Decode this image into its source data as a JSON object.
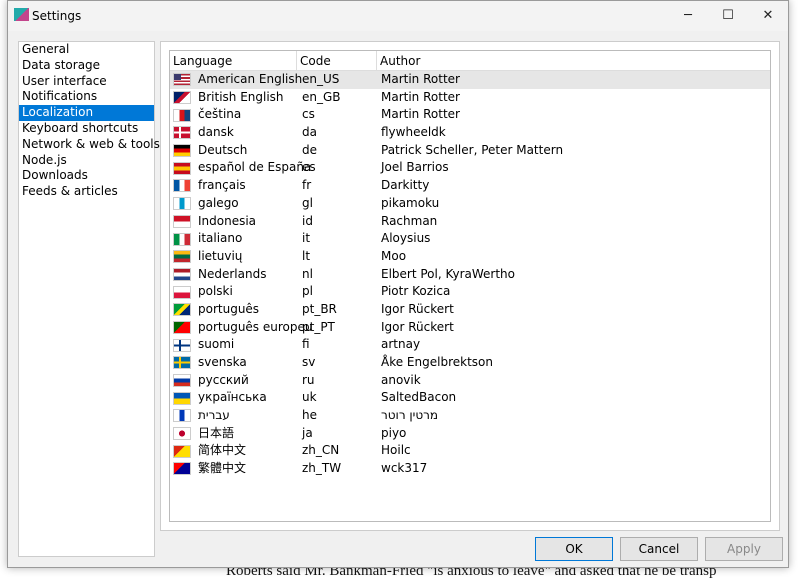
{
  "window": {
    "title": "Settings",
    "minimize": "─",
    "maximize": "☐",
    "close": "✕"
  },
  "sidebar": {
    "items": [
      {
        "label": "General"
      },
      {
        "label": "Data storage"
      },
      {
        "label": "User interface"
      },
      {
        "label": "Notifications"
      },
      {
        "label": "Localization",
        "selected": true
      },
      {
        "label": "Keyboard shortcuts"
      },
      {
        "label": "Network & web & tools"
      },
      {
        "label": "Node.js"
      },
      {
        "label": "Downloads"
      },
      {
        "label": "Feeds & articles"
      }
    ]
  },
  "table": {
    "headers": [
      "Language",
      "Code",
      "Author"
    ],
    "rows": [
      {
        "language": "American English",
        "code": "en_US",
        "author": "Martin Rotter",
        "flag": "us",
        "colors": [
          "#b22234",
          "#fff",
          "#3c3b6e"
        ]
      },
      {
        "language": "British English",
        "code": "en_GB",
        "author": "Martin Rotter",
        "flag": "gb",
        "colors": [
          "#012169",
          "#c8102e",
          "#fff"
        ]
      },
      {
        "language": "čeština",
        "code": "cs",
        "author": "Martin Rotter",
        "flag": "cz",
        "colors": [
          "#fff",
          "#d7141a",
          "#11457e"
        ]
      },
      {
        "language": "dansk",
        "code": "da",
        "author": "flywheeldk",
        "flag": "dk",
        "colors": [
          "#c8102e",
          "#fff"
        ]
      },
      {
        "language": "Deutsch",
        "code": "de",
        "author": "Patrick Scheller, Peter Mattern",
        "flag": "de",
        "colors": [
          "#000",
          "#dd0000",
          "#ffce00"
        ]
      },
      {
        "language": "español de España",
        "code": "es",
        "author": "Joel Barrios",
        "flag": "es",
        "colors": [
          "#c60b1e",
          "#ffc400",
          "#c60b1e"
        ]
      },
      {
        "language": "français",
        "code": "fr",
        "author": "Darkitty",
        "flag": "fr",
        "colors": [
          "#0055a4",
          "#fff",
          "#ef4135"
        ]
      },
      {
        "language": "galego",
        "code": "gl",
        "author": "pikamoku",
        "flag": "gl",
        "colors": [
          "#fff",
          "#0099cc",
          "#fff"
        ]
      },
      {
        "language": "Indonesia",
        "code": "id",
        "author": "Rachman",
        "flag": "id",
        "colors": [
          "#ce1126",
          "#fff"
        ]
      },
      {
        "language": "italiano",
        "code": "it",
        "author": "Aloysius",
        "flag": "it",
        "colors": [
          "#009246",
          "#fff",
          "#ce2b37"
        ]
      },
      {
        "language": "lietuvių",
        "code": "lt",
        "author": "Moo",
        "flag": "lt",
        "colors": [
          "#fdb913",
          "#006a44",
          "#c1272d"
        ]
      },
      {
        "language": "Nederlands",
        "code": "nl",
        "author": "Elbert Pol, KyraWertho",
        "flag": "nl",
        "colors": [
          "#ae1c28",
          "#fff",
          "#21468b"
        ]
      },
      {
        "language": "polski",
        "code": "pl",
        "author": "Piotr Kozica",
        "flag": "pl",
        "colors": [
          "#fff",
          "#dc143c"
        ]
      },
      {
        "language": "português",
        "code": "pt_BR",
        "author": "Igor Rückert",
        "flag": "br",
        "colors": [
          "#009c3b",
          "#ffdf00",
          "#002776"
        ]
      },
      {
        "language": "português europeu",
        "code": "pt_PT",
        "author": "Igor Rückert",
        "flag": "pt",
        "colors": [
          "#006600",
          "#ff0000"
        ]
      },
      {
        "language": "suomi",
        "code": "fi",
        "author": "artnay",
        "flag": "fi",
        "colors": [
          "#fff",
          "#003580"
        ]
      },
      {
        "language": "svenska",
        "code": "sv",
        "author": "Åke Engelbrektson",
        "flag": "se",
        "colors": [
          "#006aa7",
          "#fecc00"
        ]
      },
      {
        "language": "русский",
        "code": "ru",
        "author": "anovik",
        "flag": "ru",
        "colors": [
          "#fff",
          "#0039a6",
          "#d52b1e"
        ]
      },
      {
        "language": "українська",
        "code": "uk",
        "author": "SaltedBacon",
        "flag": "ua",
        "colors": [
          "#0057b7",
          "#ffd700"
        ]
      },
      {
        "language": "עברית",
        "code": "he",
        "author": "מרטין רוטר",
        "flag": "il",
        "colors": [
          "#fff",
          "#0038b8",
          "#fff"
        ]
      },
      {
        "language": "日本語",
        "code": "ja",
        "author": "piyo",
        "flag": "jp",
        "colors": [
          "#fff",
          "#bc002d"
        ]
      },
      {
        "language": "简体中文",
        "code": "zh_CN",
        "author": "Hoilc",
        "flag": "cn",
        "colors": [
          "#de2910",
          "#ffde00"
        ]
      },
      {
        "language": "繁體中文",
        "code": "zh_TW",
        "author": "wck317",
        "flag": "tw",
        "colors": [
          "#fe0000",
          "#000095"
        ]
      }
    ]
  },
  "buttons": {
    "ok": "OK",
    "cancel": "Cancel",
    "apply": "Apply"
  },
  "background": {
    "text": "Roberts said Mr. Bankman-Fried \"is anxious to leave\" and asked that he be transp"
  }
}
